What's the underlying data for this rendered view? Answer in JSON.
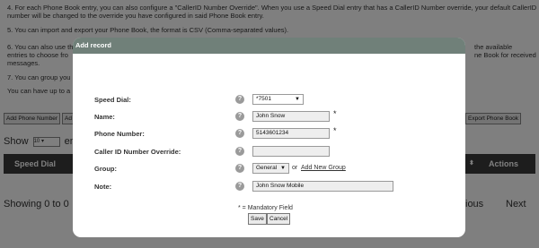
{
  "background": {
    "paragraphs": [
      "4. For each Phone Book entry, you can also configure a \"CallerID Number Override\". When you use a Speed Dial entry that has a CallerID Number override, your default CallerID number will be changed to the override you have configured in said Phone Book entry.",
      "5. You can import and export your Phone Book, the format is CSV (Comma-separated values).",
      "6. You can also use the",
      "the available",
      "entries to choose fro",
      "ne Book for received",
      "messages.",
      "7. You can group you",
      "You can have up to a"
    ],
    "buttons": {
      "add_phone_number": "Add Phone Number",
      "add_partial": "Ad",
      "export_phone_book": "Export Phone Book"
    },
    "show_label": "Show",
    "show_value": "10",
    "entries_partial": "ent",
    "table_headers": {
      "speed_dial": "Speed Dial",
      "actions": "Actions"
    },
    "showing_text": "Showing 0 to 0",
    "previous_partial": "ious",
    "next": "Next"
  },
  "dialog": {
    "title": "Add record",
    "fields": {
      "speed_dial_label": "Speed Dial:",
      "speed_dial_value": "*7501",
      "name_label": "Name:",
      "name_value": "John Snow",
      "phone_label": "Phone Number:",
      "phone_value": "5143601234",
      "callerid_label": "Caller ID Number Override:",
      "callerid_value": "",
      "group_label": "Group:",
      "group_value": "General",
      "group_or": "or",
      "add_new_group": "Add New Group",
      "note_label": "Note:",
      "note_value": "John Snow Mobile"
    },
    "help_glyph": "?",
    "required_glyph": "*",
    "mandatory_note": "* = Mandatory Field",
    "save": "Save",
    "cancel": "Cancel"
  },
  "colors": {
    "dialog_title_bar": "#708079",
    "table_header": "#3a3a3a",
    "overlay": "#7b7b7b"
  }
}
